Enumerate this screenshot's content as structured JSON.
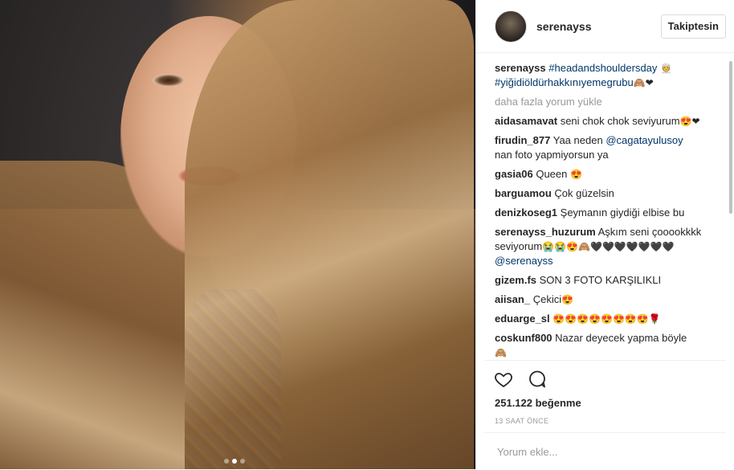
{
  "post": {
    "username": "serenayss",
    "follow_label": "Takiptesin",
    "caption": {
      "username": "serenayss",
      "tag1": "#headandshouldersday",
      "emoji1": "👳",
      "tag2": "#yiğidiöldürhakkınıyemegrubu",
      "emoji2": "🙈❤"
    },
    "load_more": "daha fazla yorum yükle",
    "comments": [
      {
        "user": "aidasamavat",
        "text": "seni chok chok seviyurum",
        "emoji": "😍❤"
      },
      {
        "user": "firudin_877",
        "text": "Yaa neden",
        "mention": "@cagatayulusoy",
        "text2": "nan foto yapmiyorsun ya"
      },
      {
        "user": "gasia06",
        "text": "Queen",
        "emoji": "😍"
      },
      {
        "user": "barguamou",
        "text": "Çok güzelsin"
      },
      {
        "user": "denizkoseg1",
        "text": "Şeymanın giydiği elbise bu"
      },
      {
        "user": "serenayss_huzurum",
        "text": "Aşkım seni çooookkkk seviyorum",
        "emoji": "😭😭😍🙈🖤🖤🖤🖤🖤🖤🖤",
        "mention": "@serenayss"
      },
      {
        "user": "gizem.fs",
        "text": "SON 3 FOTO KARŞILIKLI"
      },
      {
        "user": "aiisan_",
        "text": "Çekici",
        "emoji": "😍"
      },
      {
        "user": "eduarge_sl",
        "text": "",
        "emoji": "😍😍😍😍😍😍😍😍🌹"
      },
      {
        "user": "coskunf800",
        "text": "Nazar deyecek yapma böyle",
        "emoji": "🙈"
      }
    ],
    "likes": "251.122 beğenme",
    "time": "13 SAAT ÖNCE",
    "comment_placeholder": "Yorum ekle..."
  },
  "icons": {
    "heart": "heart-icon",
    "comment": "comment-icon"
  },
  "carousel": {
    "count": 3,
    "active_index": 1
  }
}
